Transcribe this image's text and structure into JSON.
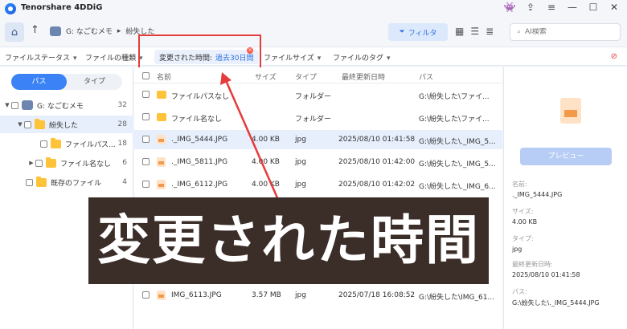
{
  "app": {
    "title": "Tenorshare 4DDiG"
  },
  "window_controls": [
    "👾",
    "⇪",
    "≡",
    "—",
    "☐",
    "✕"
  ],
  "nav": {
    "breadcrumb_drive": "G: なごむメモ",
    "breadcrumb_sep": "▸",
    "breadcrumb_folder": "紛失した",
    "filter_label": "フィルタ",
    "search_placeholder": "AI検索"
  },
  "filters": {
    "file_status": "ファイルステータス",
    "file_type": "ファイルの種類",
    "active_key": "変更された時間:",
    "active_value": "過去30日間",
    "file_size": "ファイルサイズ",
    "file_tag": "ファイルのタグ"
  },
  "sidebar": {
    "tab_path": "パス",
    "tab_type": "タイプ",
    "tree": [
      {
        "label": "G: なごむメモ",
        "count": "32"
      },
      {
        "label": "紛失した",
        "count": "28"
      },
      {
        "label": "ファイルパス...",
        "count": "18"
      },
      {
        "label": "ファイル名なし",
        "count": "6"
      },
      {
        "label": "既存のファイル",
        "count": "4"
      }
    ]
  },
  "table": {
    "columns": {
      "name": "名前",
      "size": "サイズ",
      "type": "タイプ",
      "modified": "最終更新日時",
      "path": "パス"
    },
    "rows": [
      {
        "name": "ファイルパスなし",
        "size": "",
        "type": "フォルダー",
        "modified": "",
        "path": "G:\\紛失した\\ファイ..."
      },
      {
        "name": "ファイル名なし",
        "size": "",
        "type": "フォルダー",
        "modified": "",
        "path": "G:\\紛失した\\ファイ..."
      },
      {
        "name": "._IMG_5444.JPG",
        "size": "4.00 KB",
        "type": "jpg",
        "modified": "2025/08/10 01:41:58",
        "path": "G:\\紛失した\\._IMG_5..."
      },
      {
        "name": "._IMG_5811.JPG",
        "size": "4.00 KB",
        "type": "jpg",
        "modified": "2025/08/10 01:42:00",
        "path": "G:\\紛失した\\._IMG_5..."
      },
      {
        "name": "._IMG_6112.JPG",
        "size": "4.00 KB",
        "type": "jpg",
        "modified": "2025/08/10 01:42:02",
        "path": "G:\\紛失した\\._IMG_6..."
      },
      {
        "name": "IMG_6113.JPG",
        "size": "3.57 MB",
        "type": "jpg",
        "modified": "2025/07/18 16:08:52",
        "path": "G:\\紛失した\\IMG_61..."
      }
    ]
  },
  "preview": {
    "button": "プレビュー",
    "name_key": "名前:",
    "name_val": "._IMG_5444.JPG",
    "size_key": "サイズ:",
    "size_val": "4.00 KB",
    "type_key": "タイプ:",
    "type_val": "jpg",
    "modified_key": "最終更新日時:",
    "modified_val": "2025/08/10 01:41:58",
    "path_key": "パス:",
    "path_val": "G:\\紛失した\\._IMG_5444.JPG"
  },
  "overlay": {
    "caption": "変更された時間"
  }
}
